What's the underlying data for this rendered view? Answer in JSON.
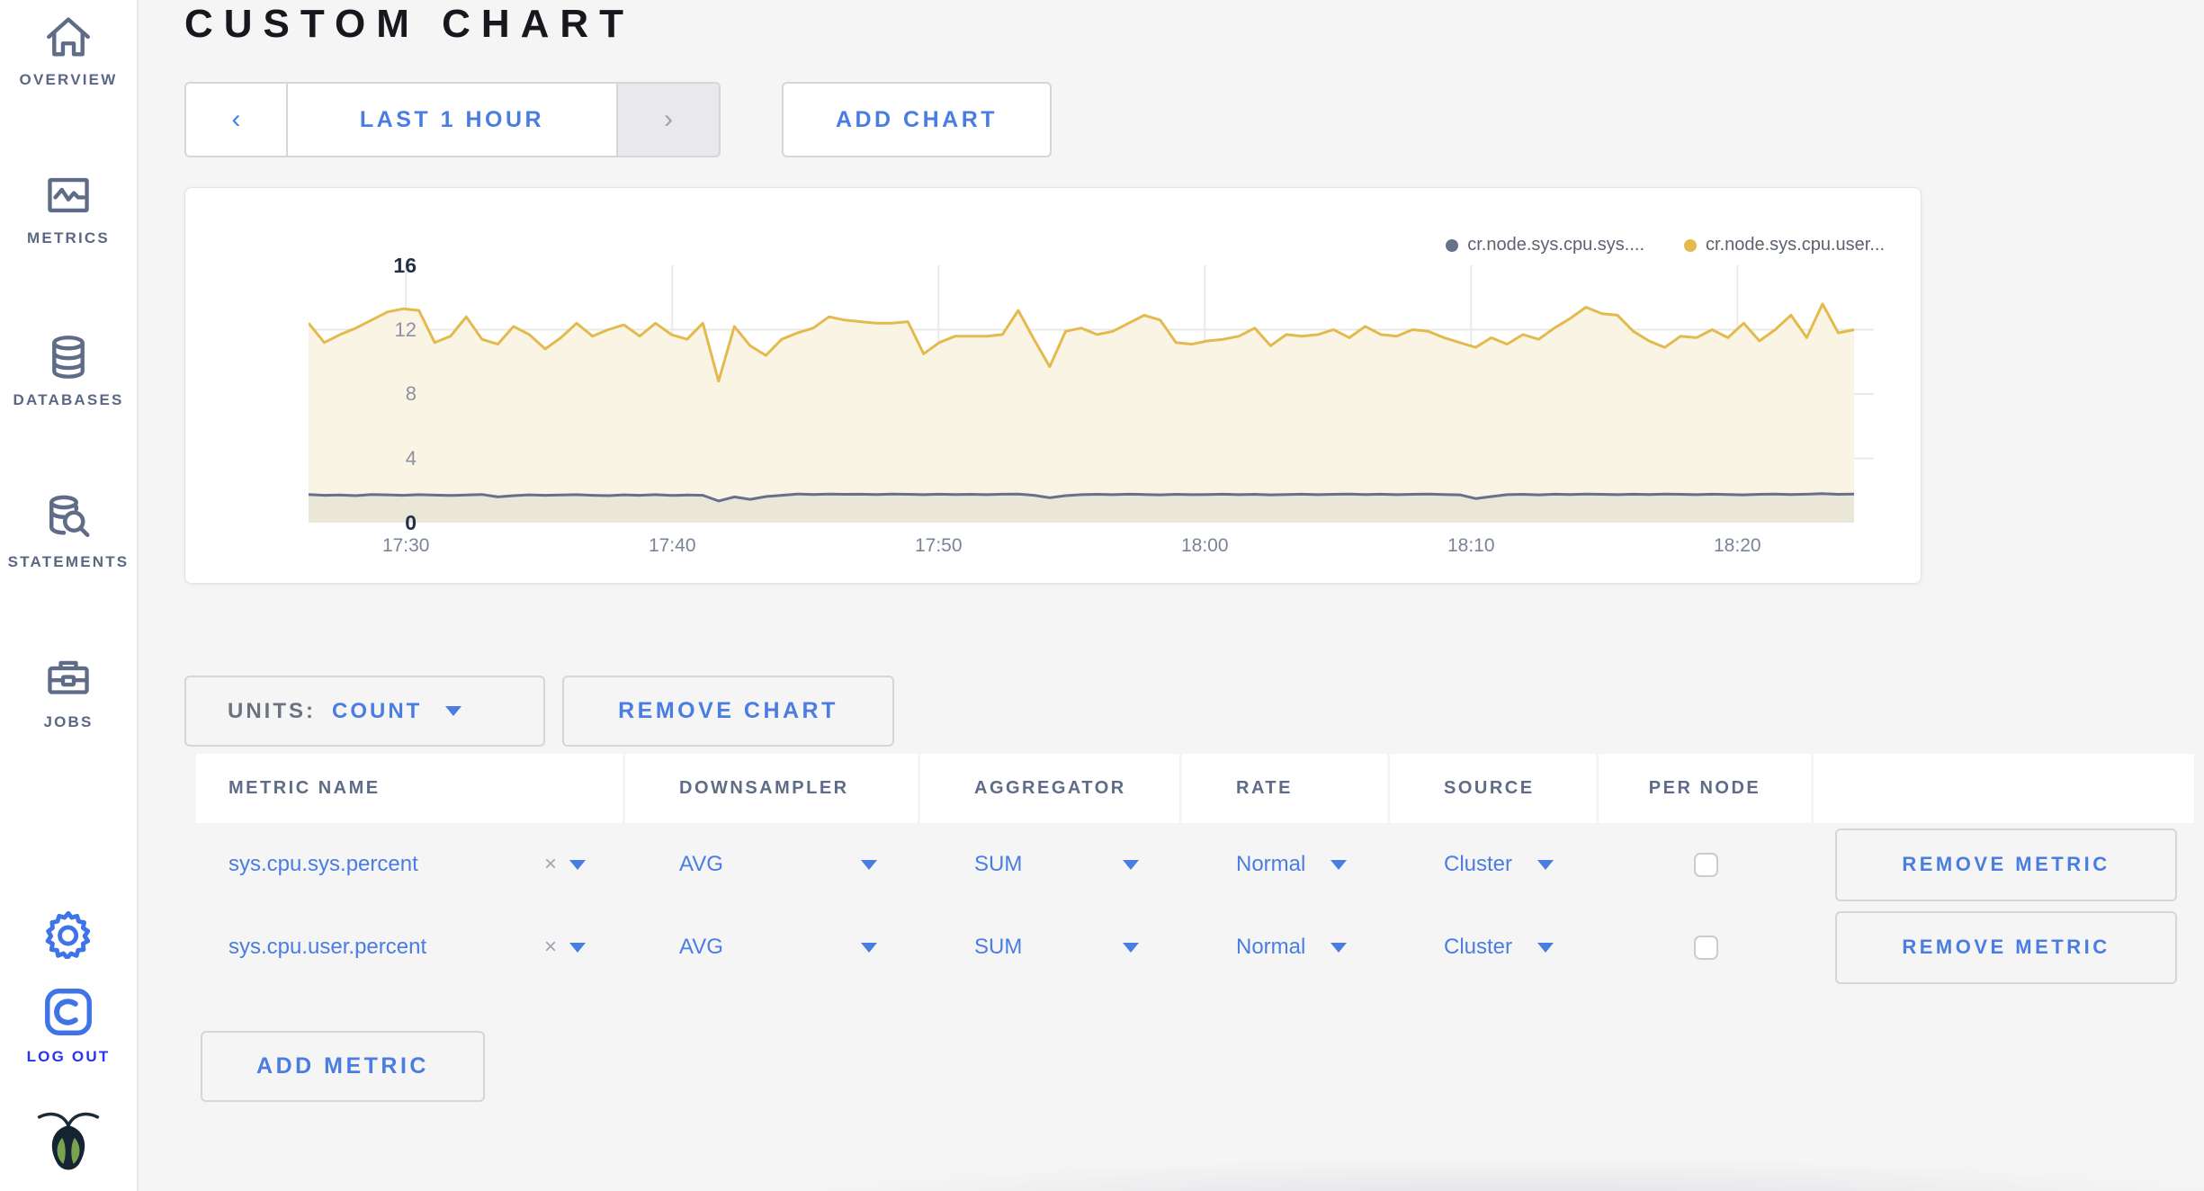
{
  "header": {
    "title": "CUSTOM CHART"
  },
  "sidebar": {
    "items": [
      {
        "label": "OVERVIEW",
        "icon": "home-icon"
      },
      {
        "label": "METRICS",
        "icon": "metrics-icon"
      },
      {
        "label": "DATABASES",
        "icon": "database-icon"
      },
      {
        "label": "STATEMENTS",
        "icon": "statements-icon"
      },
      {
        "label": "JOBS",
        "icon": "briefcase-icon"
      }
    ],
    "gear_icon": "gear-icon",
    "logout": {
      "label": "LOG OUT",
      "icon": "cockroach-c-icon"
    },
    "brand_icon": "cockroach-bug-icon"
  },
  "toolbar": {
    "prev_arrow": "‹",
    "time_range": "LAST 1 HOUR",
    "next_arrow": "›",
    "add_chart": "ADD CHART"
  },
  "chart_data": {
    "type": "line",
    "title": "",
    "xlabel": "",
    "ylabel": "",
    "ylim": [
      0,
      16
    ],
    "yticks": [
      0,
      4,
      8,
      12,
      16
    ],
    "grid": true,
    "legend_position": "top-right",
    "x_ticks": [
      "17:30",
      "17:40",
      "17:50",
      "18:00",
      "18:10",
      "18:20"
    ],
    "x_window": "last 1 hour (~17:26 – 18:26)",
    "series": [
      {
        "name": "cr.node.sys.cpu.sys....",
        "color": "#667189",
        "fill": "rgba(95,103,117,0.10)",
        "values": [
          1.75,
          1.7,
          1.72,
          1.68,
          1.75,
          1.73,
          1.7,
          1.74,
          1.71,
          1.69,
          1.72,
          1.75,
          1.6,
          1.68,
          1.73,
          1.7,
          1.72,
          1.74,
          1.7,
          1.68,
          1.73,
          1.7,
          1.74,
          1.69,
          1.72,
          1.7,
          1.35,
          1.6,
          1.45,
          1.62,
          1.7,
          1.78,
          1.75,
          1.78,
          1.76,
          1.77,
          1.75,
          1.78,
          1.76,
          1.74,
          1.77,
          1.75,
          1.76,
          1.74,
          1.77,
          1.78,
          1.7,
          1.55,
          1.68,
          1.74,
          1.76,
          1.74,
          1.77,
          1.75,
          1.73,
          1.76,
          1.74,
          1.75,
          1.77,
          1.74,
          1.76,
          1.73,
          1.75,
          1.77,
          1.74,
          1.76,
          1.78,
          1.75,
          1.77,
          1.74,
          1.76,
          1.78,
          1.75,
          1.73,
          1.5,
          1.62,
          1.74,
          1.76,
          1.73,
          1.77,
          1.75,
          1.78,
          1.76,
          1.74,
          1.77,
          1.75,
          1.78,
          1.76,
          1.74,
          1.77,
          1.75,
          1.73,
          1.76,
          1.78,
          1.75,
          1.77,
          1.8,
          1.76,
          1.78
        ]
      },
      {
        "name": "cr.node.sys.cpu.user...",
        "color": "#e3ba4d",
        "fill": "#faf4e4",
        "values": [
          12.4,
          11.2,
          11.7,
          12.1,
          12.6,
          13.1,
          13.3,
          13.2,
          11.2,
          11.6,
          12.8,
          11.4,
          11.1,
          12.2,
          11.7,
          10.8,
          11.5,
          12.4,
          11.6,
          12.0,
          12.3,
          11.6,
          12.4,
          11.7,
          11.4,
          12.4,
          8.8,
          12.2,
          11.0,
          10.4,
          11.4,
          11.8,
          12.1,
          12.8,
          12.6,
          12.5,
          12.4,
          12.4,
          12.5,
          10.5,
          11.2,
          11.6,
          11.6,
          11.6,
          11.7,
          13.2,
          11.4,
          9.7,
          11.9,
          12.1,
          11.7,
          11.9,
          12.4,
          12.9,
          12.6,
          11.2,
          11.1,
          11.3,
          11.4,
          11.6,
          12.1,
          11.0,
          11.7,
          11.6,
          11.7,
          12.0,
          11.5,
          12.2,
          11.7,
          11.6,
          12.0,
          11.9,
          11.5,
          11.2,
          10.9,
          11.5,
          11.1,
          11.7,
          11.4,
          12.1,
          12.7,
          13.4,
          13.0,
          12.9,
          11.9,
          11.3,
          10.9,
          11.6,
          11.5,
          12.0,
          11.5,
          12.4,
          11.3,
          12.0,
          12.9,
          11.5,
          13.6,
          11.8,
          12.0
        ]
      }
    ]
  },
  "chart_panel": {
    "legend": [
      {
        "label": "cr.node.sys.cpu.sys...."
      },
      {
        "label": "cr.node.sys.cpu.user..."
      }
    ]
  },
  "units": {
    "label": "UNITS:",
    "value": "COUNT"
  },
  "remove_chart_label": "REMOVE CHART",
  "table": {
    "columns": [
      "METRIC NAME",
      "DOWNSAMPLER",
      "AGGREGATOR",
      "RATE",
      "SOURCE",
      "PER NODE",
      ""
    ],
    "clear_glyph": "×",
    "rows": [
      {
        "metric": "sys.cpu.sys.percent",
        "downsampler": "AVG",
        "aggregator": "SUM",
        "rate": "Normal",
        "source": "Cluster",
        "per_node": false,
        "remove_label": "REMOVE METRIC"
      },
      {
        "metric": "sys.cpu.user.percent",
        "downsampler": "AVG",
        "aggregator": "SUM",
        "rate": "Normal",
        "source": "Cluster",
        "per_node": false,
        "remove_label": "REMOVE METRIC"
      }
    ]
  },
  "add_metric_label": "ADD METRIC",
  "colors": {
    "accent_blue": "#4a7de2",
    "logout_blue": "#2633ef",
    "slate": "#5f6c87"
  }
}
